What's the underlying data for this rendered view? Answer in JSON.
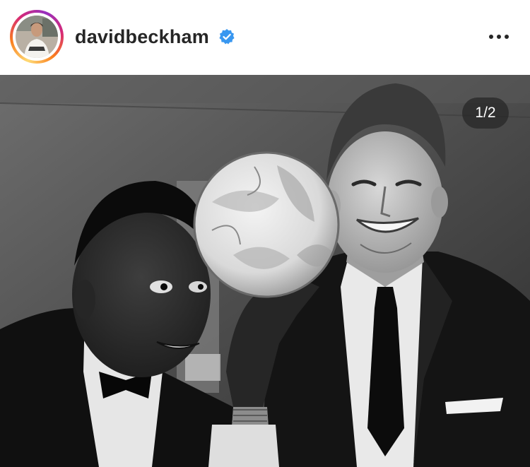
{
  "post": {
    "username": "davidbeckham",
    "verified_icon": "verified-badge-icon",
    "more_icon": "more-options-icon",
    "carousel_counter": "1/2",
    "accent_color": "#3897f0"
  }
}
